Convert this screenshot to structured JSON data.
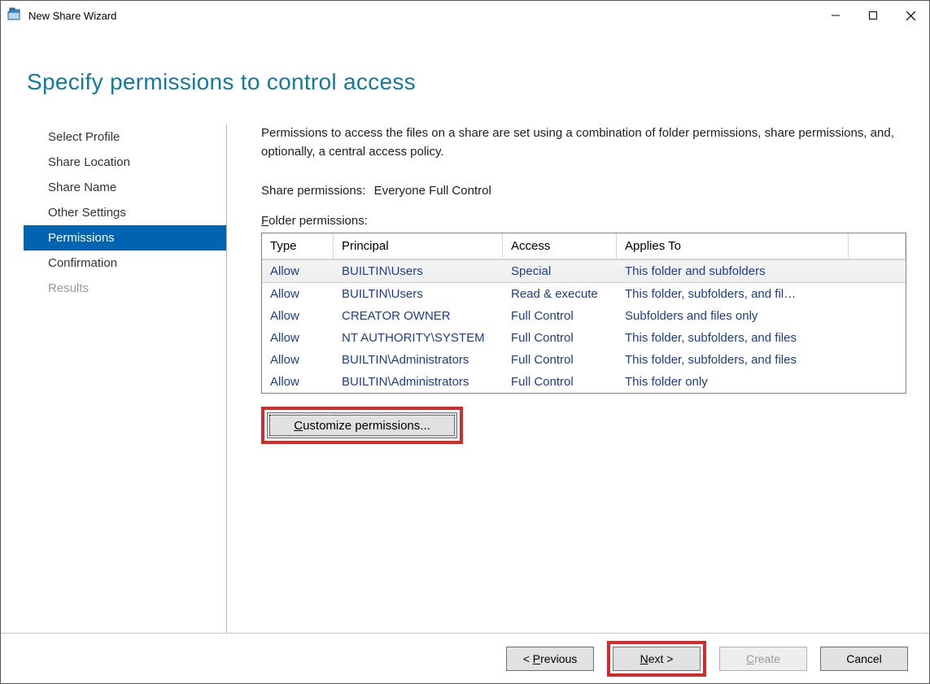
{
  "window": {
    "title": "New Share Wizard"
  },
  "heading": "Specify permissions to control access",
  "steps": [
    {
      "label": "Select Profile",
      "state": "normal"
    },
    {
      "label": "Share Location",
      "state": "normal"
    },
    {
      "label": "Share Name",
      "state": "normal"
    },
    {
      "label": "Other Settings",
      "state": "normal"
    },
    {
      "label": "Permissions",
      "state": "selected"
    },
    {
      "label": "Confirmation",
      "state": "normal"
    },
    {
      "label": "Results",
      "state": "disabled"
    }
  ],
  "desc": "Permissions to access the files on a share are set using a combination of folder permissions, share permissions, and, optionally, a central access policy.",
  "share_perm_label": "Share permissions:",
  "share_perm_value": "Everyone Full Control",
  "folder_perm_label_pre": "F",
  "folder_perm_label_rest": "older permissions:",
  "columns": {
    "type": "Type",
    "principal": "Principal",
    "access": "Access",
    "applies": "Applies To"
  },
  "rows": [
    {
      "type": "Allow",
      "principal": "BUILTIN\\Users",
      "access": "Special",
      "applies": "This folder and subfolders"
    },
    {
      "type": "Allow",
      "principal": "BUILTIN\\Users",
      "access": "Read & execute",
      "applies": "This folder, subfolders, and fil…"
    },
    {
      "type": "Allow",
      "principal": "CREATOR OWNER",
      "access": "Full Control",
      "applies": "Subfolders and files only"
    },
    {
      "type": "Allow",
      "principal": "NT AUTHORITY\\SYSTEM",
      "access": "Full Control",
      "applies": "This folder, subfolders, and files"
    },
    {
      "type": "Allow",
      "principal": "BUILTIN\\Administrators",
      "access": "Full Control",
      "applies": "This folder, subfolders, and files"
    },
    {
      "type": "Allow",
      "principal": "BUILTIN\\Administrators",
      "access": "Full Control",
      "applies": "This folder only"
    }
  ],
  "customize_pre": "C",
  "customize_rest": "ustomize permissions...",
  "buttons": {
    "prev_pre": "< ",
    "prev_accel": "P",
    "prev_rest": "revious",
    "next_accel": "N",
    "next_rest": "ext >",
    "create_pre": "",
    "create_accel": "C",
    "create_rest": "reate",
    "cancel": "Cancel"
  }
}
